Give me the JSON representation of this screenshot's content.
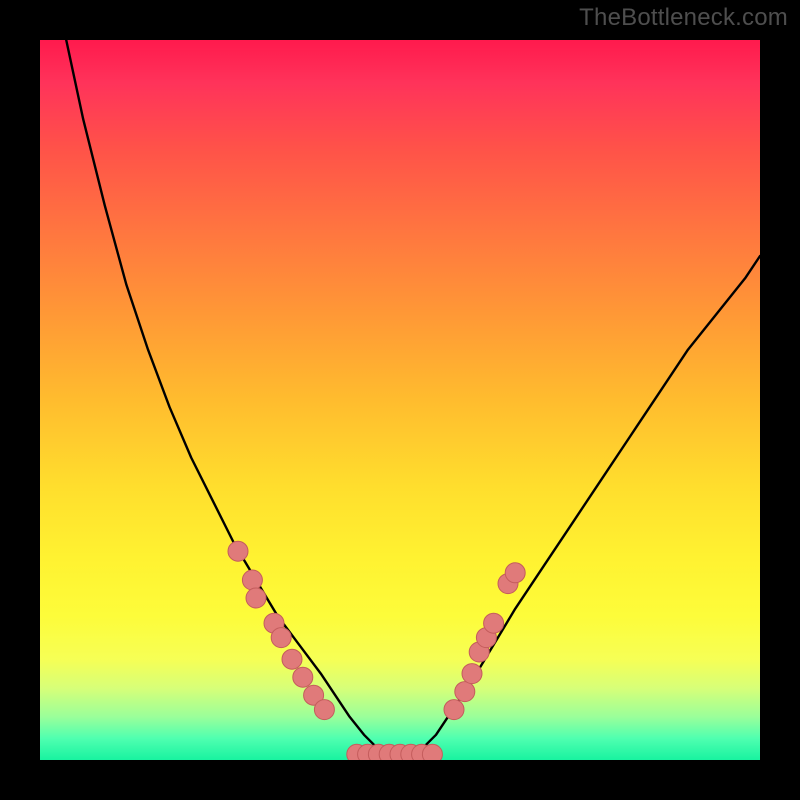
{
  "watermark": "TheBottleneck.com",
  "gradient_colors": {
    "top": "#ff1a4d",
    "mid_upper": "#ff9836",
    "mid": "#ffde2d",
    "mid_lower": "#fdfc3a",
    "lower": "#9aff9a",
    "bottom": "#18f3a0"
  },
  "curve_color": "#000000",
  "marker_color": "#e07a7a",
  "marker_stroke": "#c45c5c",
  "chart_data": {
    "type": "line",
    "title": "",
    "xlabel": "",
    "ylabel": "",
    "xlim": [
      0,
      100
    ],
    "ylim": [
      0,
      100
    ],
    "series": [
      {
        "name": "bottleneck-curve",
        "x": [
          0,
          3,
          6,
          9,
          12,
          15,
          18,
          21,
          24,
          27,
          30,
          33,
          36,
          39,
          41,
          43,
          45,
          47,
          49,
          51,
          53,
          55,
          57,
          60,
          63,
          66,
          70,
          74,
          78,
          82,
          86,
          90,
          94,
          98,
          100
        ],
        "y": [
          118,
          103,
          89,
          77,
          66,
          57,
          49,
          42,
          36,
          30,
          25,
          20,
          16,
          12,
          9,
          6,
          3.5,
          1.5,
          0.5,
          0.5,
          1.5,
          3.5,
          6.5,
          11,
          16,
          21,
          27,
          33,
          39,
          45,
          51,
          57,
          62,
          67,
          70
        ]
      }
    ],
    "markers_left": [
      {
        "x": 27.5,
        "y": 29
      },
      {
        "x": 29.5,
        "y": 25
      },
      {
        "x": 30.0,
        "y": 22.5
      },
      {
        "x": 32.5,
        "y": 19
      },
      {
        "x": 33.5,
        "y": 17
      },
      {
        "x": 35.0,
        "y": 14
      },
      {
        "x": 36.5,
        "y": 11.5
      },
      {
        "x": 38.0,
        "y": 9
      },
      {
        "x": 39.5,
        "y": 7
      }
    ],
    "markers_right": [
      {
        "x": 57.5,
        "y": 7
      },
      {
        "x": 59.0,
        "y": 9.5
      },
      {
        "x": 60.0,
        "y": 12
      },
      {
        "x": 61.0,
        "y": 15
      },
      {
        "x": 62.0,
        "y": 17
      },
      {
        "x": 63.0,
        "y": 19
      },
      {
        "x": 65.0,
        "y": 24.5
      },
      {
        "x": 66.0,
        "y": 26
      }
    ],
    "markers_bottom": [
      {
        "x": 44.0,
        "y": 0.8
      },
      {
        "x": 45.5,
        "y": 0.8
      },
      {
        "x": 47.0,
        "y": 0.8
      },
      {
        "x": 48.5,
        "y": 0.8
      },
      {
        "x": 50.0,
        "y": 0.8
      },
      {
        "x": 51.5,
        "y": 0.8
      },
      {
        "x": 53.0,
        "y": 0.8
      },
      {
        "x": 54.5,
        "y": 0.8
      }
    ]
  }
}
